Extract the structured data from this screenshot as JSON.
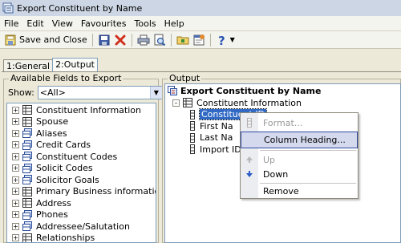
{
  "window": {
    "title": "Export Constituent by Name"
  },
  "menu": [
    "File",
    "Edit",
    "View",
    "Favourites",
    "Tools",
    "Help"
  ],
  "toolbar": {
    "save_close_label": "Save and Close",
    "buttons": [
      "save-and-close",
      "save",
      "delete",
      "print",
      "preview",
      "export-folder",
      "properties",
      "help",
      "help-dropdown"
    ]
  },
  "tabs": [
    {
      "label": "1:General"
    },
    {
      "label": "2:Output"
    }
  ],
  "available": {
    "group_label": "Available Fields to Export",
    "show_label": "Show:",
    "show_value": "<All>",
    "items": [
      "Constituent Information",
      "Spouse",
      "Aliases",
      "Credit Cards",
      "Constituent Codes",
      "Solicit Codes",
      "Solicitor Goals",
      "Primary Business information",
      "Address",
      "Phones",
      "Addressee/Salutation",
      "Relationships"
    ]
  },
  "output": {
    "group_label": "Output",
    "root": "Export Constituent by Name",
    "folder": "Constituent Information",
    "fields": [
      "Constituent ID",
      "First Na",
      "Last Na",
      "Import ID"
    ]
  },
  "context_menu": {
    "items": [
      {
        "label": "Format...",
        "disabled": true
      },
      {
        "label": "Column Heading...",
        "highlighted": true
      },
      {
        "label": "Up",
        "disabled": true
      },
      {
        "label": "Down"
      },
      {
        "label": "Remove"
      }
    ]
  },
  "colors": {
    "selection": "#316ac5",
    "menu_highlight": "#d4d9ee",
    "panel_bg": "#ece9d8"
  }
}
